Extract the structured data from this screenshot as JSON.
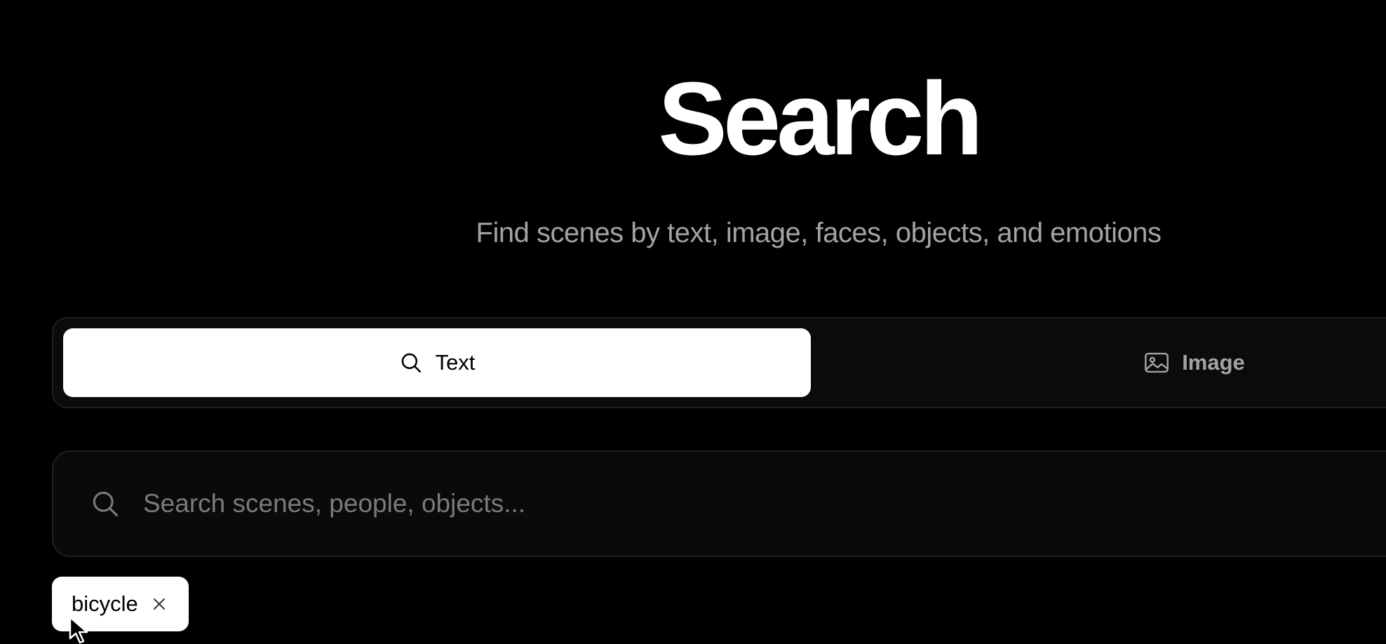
{
  "page": {
    "title": "Search",
    "subtitle": "Find scenes by text, image, faces, objects, and emotions"
  },
  "mode_tabs": [
    {
      "label": "Text",
      "icon": "search-icon",
      "selected": true
    },
    {
      "label": "Image",
      "icon": "image-icon",
      "selected": false
    }
  ],
  "search": {
    "placeholder": "Search scenes, people, objects...",
    "value": "",
    "icon": "search-icon"
  },
  "filter_chips": [
    {
      "label": "bicycle",
      "remove_icon": "close-icon"
    }
  ],
  "colors": {
    "background": "#000000",
    "title": "#ffffff",
    "subtitle": "#a3a3a3",
    "active_tab_bg": "#ffffff",
    "inactive_tab_text": "#a3a3a3",
    "panel_bg": "#0b0b0b",
    "panel_border": "#1f1f1f",
    "placeholder": "#7a7a7a"
  }
}
